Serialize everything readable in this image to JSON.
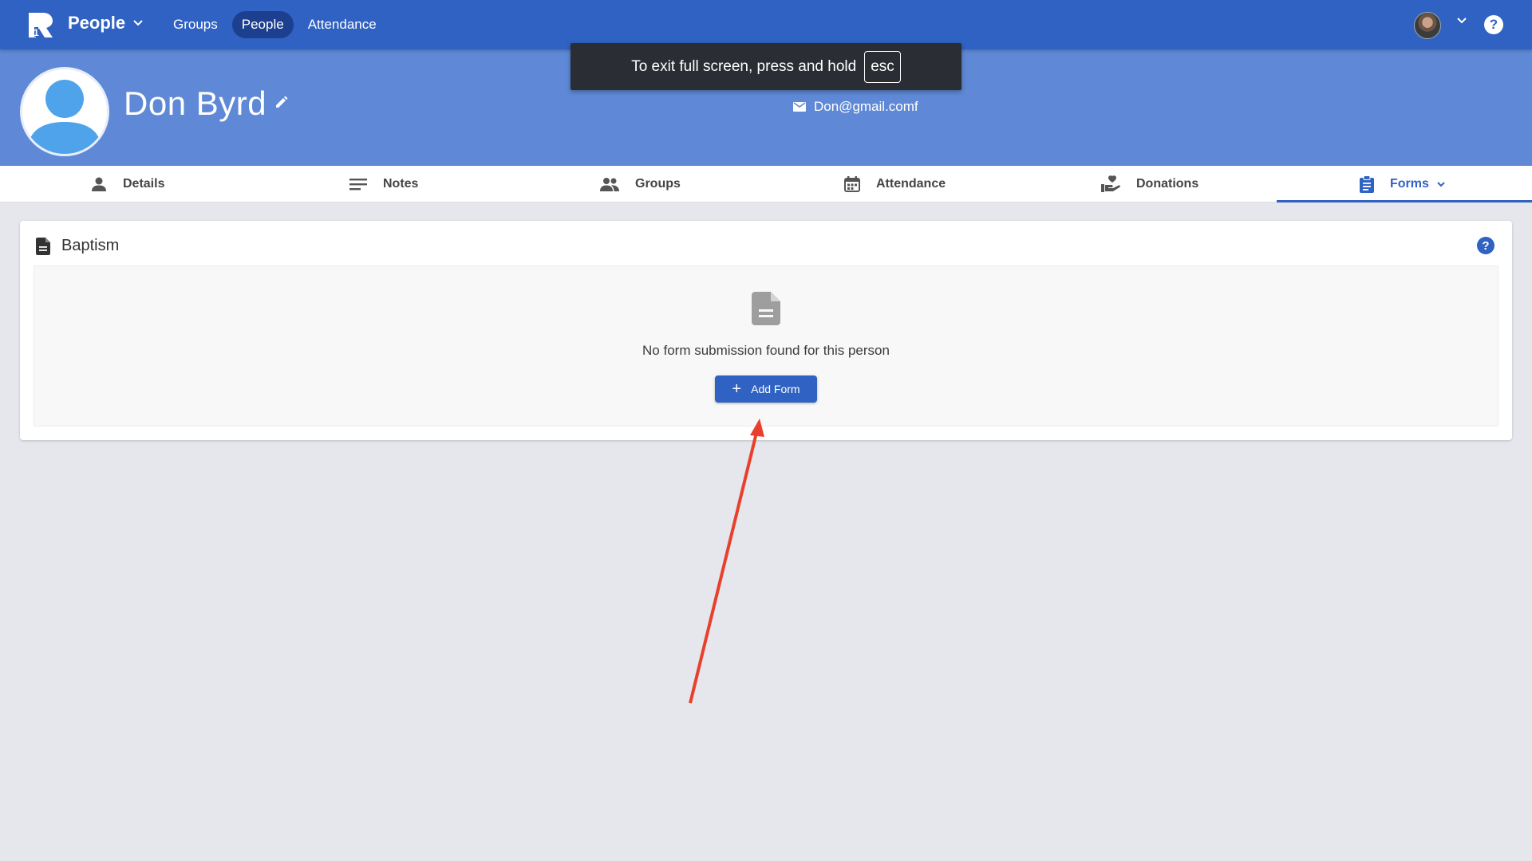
{
  "app": {
    "title": "People",
    "nav": [
      {
        "label": "Groups",
        "active": false
      },
      {
        "label": "People",
        "active": true
      },
      {
        "label": "Attendance",
        "active": false
      }
    ],
    "help_glyph": "?"
  },
  "person": {
    "name": "Don Byrd",
    "email": "Don@gmail.comf"
  },
  "toast": {
    "text": "To exit full screen, press and hold",
    "key": "esc"
  },
  "tabs": [
    {
      "label": "Details",
      "icon": "person-icon"
    },
    {
      "label": "Notes",
      "icon": "notes-icon"
    },
    {
      "label": "Groups",
      "icon": "groups-icon"
    },
    {
      "label": "Attendance",
      "icon": "calendar-icon"
    },
    {
      "label": "Donations",
      "icon": "donation-icon"
    },
    {
      "label": "Forms",
      "icon": "clipboard-icon",
      "active": true
    }
  ],
  "card": {
    "title": "Baptism",
    "empty_message": "No form submission found for this person",
    "add_button": "Add Form",
    "help_glyph": "?"
  },
  "colors": {
    "topbar": "#2f62c2",
    "profile_band": "#5f89d6",
    "accent": "#2f62c2",
    "annotation_arrow": "#e8402c"
  }
}
